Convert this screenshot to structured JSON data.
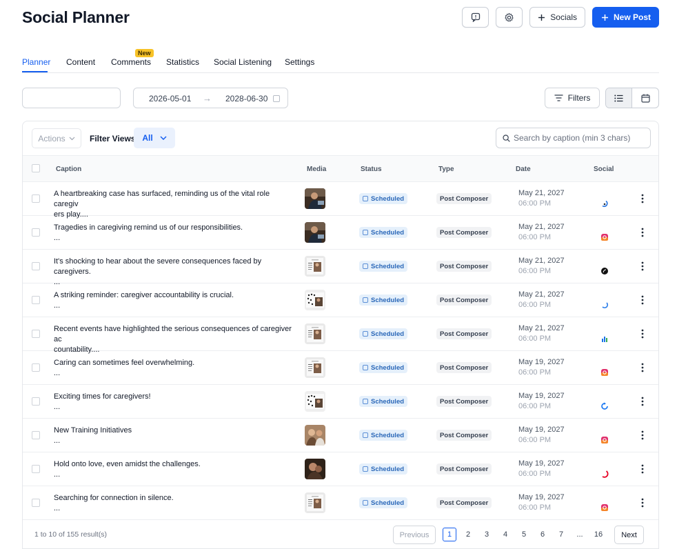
{
  "header": {
    "title": "Social Planner",
    "socials_label": "Socials",
    "new_post_label": "New Post"
  },
  "tabs": [
    {
      "label": "Planner",
      "active": true
    },
    {
      "label": "Content"
    },
    {
      "label": "Comments",
      "badge": "New"
    },
    {
      "label": "Statistics"
    },
    {
      "label": "Social Listening"
    },
    {
      "label": "Settings"
    }
  ],
  "filters": {
    "date_from": "2026-05-01",
    "date_to": "2028-06-30",
    "filters_label": "Filters"
  },
  "toolbar": {
    "actions_label": "Actions",
    "filter_views_label": "Filter Views:",
    "filter_view_value": "All",
    "search_placeholder": "Search by caption (min 3 chars)"
  },
  "table": {
    "headers": {
      "caption": "Caption",
      "media": "Media",
      "status": "Status",
      "type": "Type",
      "date": "Date",
      "social": "Social"
    },
    "rows": [
      {
        "caption1": "A heartbreaking case has surfaced, reminding us of the vital role caregiv",
        "caption2": "ers play....",
        "status": "Scheduled",
        "type": "Post Composer",
        "date": "May 21, 2027",
        "time": "06:00 PM",
        "media": "photo-dark",
        "social": "threads-icon"
      },
      {
        "caption1": "Tragedies in caregiving remind us of our responsibilities.",
        "caption2": "...",
        "status": "Scheduled",
        "type": "Post Composer",
        "date": "May 21, 2027",
        "time": "06:00 PM",
        "media": "photo-dark",
        "social": "instagram-icon"
      },
      {
        "caption1": "It's shocking to hear about the severe consequences faced by caregivers.",
        "caption2": "...",
        "status": "Scheduled",
        "type": "Post Composer",
        "date": "May 21, 2027",
        "time": "06:00 PM",
        "media": "doc-light",
        "social": "tiktok-icon"
      },
      {
        "caption1": "A striking reminder: caregiver accountability is crucial.",
        "caption2": "...",
        "status": "Scheduled",
        "type": "Post Composer",
        "date": "May 21, 2027",
        "time": "06:00 PM",
        "media": "doc-dots",
        "social": "bluesky-icon"
      },
      {
        "caption1": "Recent events have highlighted the serious consequences of caregiver ac",
        "caption2": "countability....",
        "status": "Scheduled",
        "type": "Post Composer",
        "date": "May 21, 2027",
        "time": "06:00 PM",
        "media": "doc-light",
        "social": "gmb-icon"
      },
      {
        "caption1": "Caring can sometimes feel overwhelming.",
        "caption2": "...",
        "status": "Scheduled",
        "type": "Post Composer",
        "date": "May 19, 2027",
        "time": "06:00 PM",
        "media": "doc-light",
        "social": "instagram-icon"
      },
      {
        "caption1": "Exciting times for caregivers!",
        "caption2": "...",
        "status": "Scheduled",
        "type": "Post Composer",
        "date": "May 19, 2027",
        "time": "06:00 PM",
        "media": "doc-dots",
        "social": "facebook-icon"
      },
      {
        "caption1": "New Training Initiatives",
        "caption2": "...",
        "status": "Scheduled",
        "type": "Post Composer",
        "date": "May 19, 2027",
        "time": "06:00 PM",
        "media": "photo-warm",
        "social": "instagram-icon"
      },
      {
        "caption1": "Hold onto love, even amidst the challenges.",
        "caption2": "...",
        "status": "Scheduled",
        "type": "Post Composer",
        "date": "May 19, 2027",
        "time": "06:00 PM",
        "media": "photo-brown",
        "social": "pinterest-icon"
      },
      {
        "caption1": "Searching for connection in silence.",
        "caption2": "...",
        "status": "Scheduled",
        "type": "Post Composer",
        "date": "May 19, 2027",
        "time": "06:00 PM",
        "media": "doc-light",
        "social": "instagram-icon"
      }
    ]
  },
  "pagination": {
    "results_text": "1 to 10 of 155 result(s)",
    "previous_label": "Previous",
    "next_label": "Next",
    "pages": [
      "1",
      "2",
      "3",
      "4",
      "5",
      "6",
      "7",
      "...",
      "16"
    ],
    "current": "1"
  },
  "colors": {
    "accent": "#155eef",
    "status_bg": "#e5f0fb",
    "badge_new": "#f7c227"
  }
}
